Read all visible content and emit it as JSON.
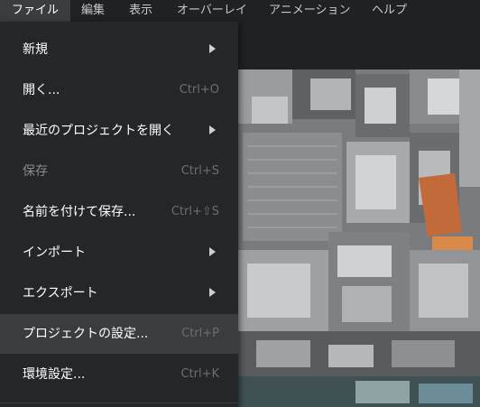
{
  "menubar": {
    "items": [
      {
        "label": "ファイル",
        "active": true
      },
      {
        "label": "編集"
      },
      {
        "label": "表示"
      },
      {
        "label": "オーバーレイ"
      },
      {
        "label": "アニメーション"
      },
      {
        "label": "ヘルプ"
      }
    ]
  },
  "file_menu": {
    "items": [
      {
        "label": "新規",
        "shortcut": "",
        "submenu": true,
        "disabled": false,
        "highlighted": false
      },
      {
        "label": "開く...",
        "shortcut": "Ctrl+O",
        "submenu": false,
        "disabled": false,
        "highlighted": false
      },
      {
        "label": "最近のプロジェクトを開く",
        "shortcut": "",
        "submenu": true,
        "disabled": false,
        "highlighted": false
      },
      {
        "label": "保存",
        "shortcut": "Ctrl+S",
        "submenu": false,
        "disabled": true,
        "highlighted": false
      },
      {
        "label": "名前を付けて保存...",
        "shortcut": "Ctrl+⇧S",
        "submenu": false,
        "disabled": false,
        "highlighted": false
      },
      {
        "label": "インポート",
        "shortcut": "",
        "submenu": true,
        "disabled": false,
        "highlighted": false
      },
      {
        "label": "エクスポート",
        "shortcut": "",
        "submenu": true,
        "disabled": false,
        "highlighted": false
      },
      {
        "label": "プロジェクトの設定...",
        "shortcut": "Ctrl+P",
        "submenu": false,
        "disabled": false,
        "highlighted": true
      },
      {
        "label": "環境設定...",
        "shortcut": "Ctrl+K",
        "submenu": false,
        "disabled": false,
        "highlighted": false
      }
    ]
  },
  "map_view": {
    "content": "aerial-city-imagery"
  }
}
